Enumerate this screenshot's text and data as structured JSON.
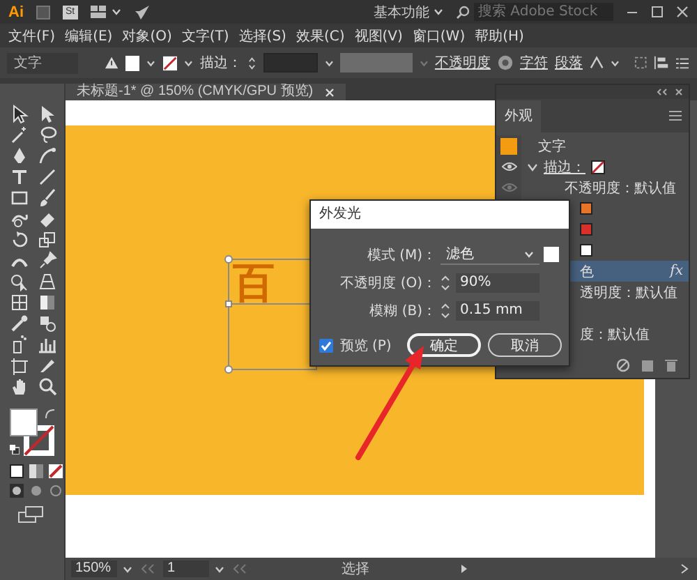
{
  "app": {
    "logo": "Ai",
    "stock_badge": "St",
    "workspace": "基本功能",
    "search": {
      "placeholder": "搜索 Adobe Stock"
    }
  },
  "menu": [
    "文件(F)",
    "编辑(E)",
    "对象(O)",
    "文字(T)",
    "选择(S)",
    "效果(C)",
    "视图(V)",
    "窗口(W)",
    "帮助(H)"
  ],
  "control_bar": {
    "object_type": "文字",
    "stroke_label": "描边：",
    "opacity_link": "不透明度",
    "character_link": "字符",
    "paragraph_link": "段落"
  },
  "document_tab": {
    "title": "未标题-1* @ 150% (CMYK/GPU 预览)"
  },
  "canvas": {
    "text": "百"
  },
  "appearance_panel": {
    "tab": "外观",
    "rows": [
      {
        "kind": "object",
        "label": "文字",
        "color": "#f39c12",
        "selected": false
      },
      {
        "kind": "stroke",
        "label": "描边：",
        "expanded": true,
        "selected": false
      },
      {
        "kind": "property",
        "label": "不透明度：默认值",
        "selected": false
      },
      {
        "kind": "swatch",
        "color": "#e8742a",
        "selected": false
      },
      {
        "kind": "swatch",
        "color": "#d8312c",
        "selected": false
      },
      {
        "kind": "swatch",
        "color": "#ffffff",
        "selected": false
      },
      {
        "kind": "effect",
        "label": "色",
        "badge": "fx",
        "selected": true
      },
      {
        "kind": "clipped",
        "label": "透明度：默认值",
        "selected": false
      },
      {
        "kind": "clipped",
        "label": "度：默认值",
        "selected": false
      }
    ]
  },
  "dialog": {
    "title": "外发光",
    "fields": [
      {
        "kind": "select",
        "label": "模式 (M)：",
        "value": "滤色"
      },
      {
        "kind": "spin",
        "label": "不透明度 (O)：",
        "value": "90%"
      },
      {
        "kind": "spin",
        "label": "模糊 (B)：",
        "value": "0.15 mm"
      }
    ],
    "preview": {
      "label": "预览 (P)",
      "checked": true
    },
    "buttons": [
      {
        "label": "确定",
        "default": true
      },
      {
        "label": "取消",
        "default": false
      }
    ]
  },
  "status_bar": {
    "zoom": "150%",
    "artboard": "1",
    "tool": "选择"
  }
}
